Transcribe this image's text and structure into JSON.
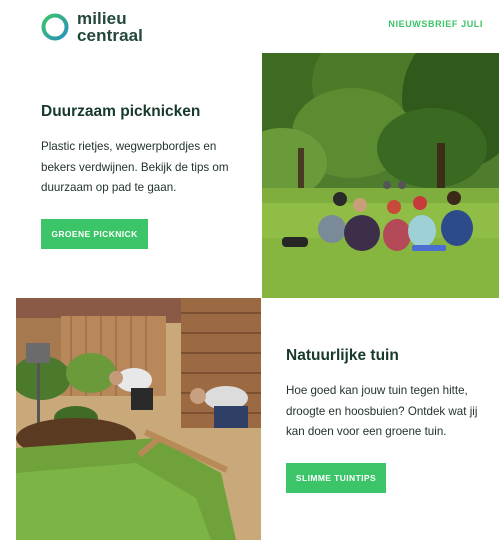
{
  "brand": {
    "line1": "milieu",
    "line2": "centraal",
    "ring_color_a": "#3cc468",
    "ring_color_b": "#2a8fbd"
  },
  "header": {
    "newsletter_label": "NIEUWSBRIEF JULI"
  },
  "picnic": {
    "title": "Duurzaam picknicken",
    "body": "Plastic rietjes, wegwerpbordjes en bekers verdwijnen. Bekijk de tips om duurzaam op pad te gaan.",
    "button_label": "GROENE PICKNICK"
  },
  "garden": {
    "title": "Natuurlijke tuin",
    "body": "Hoe goed kan jouw tuin tegen hitte, droogte en hoosbuien? Ontdek wat jij kan doen voor een groene tuin.",
    "button_label": "SLIMME TUINTIPS"
  },
  "colors": {
    "accent": "#3cc468",
    "heading": "#173a2a"
  }
}
